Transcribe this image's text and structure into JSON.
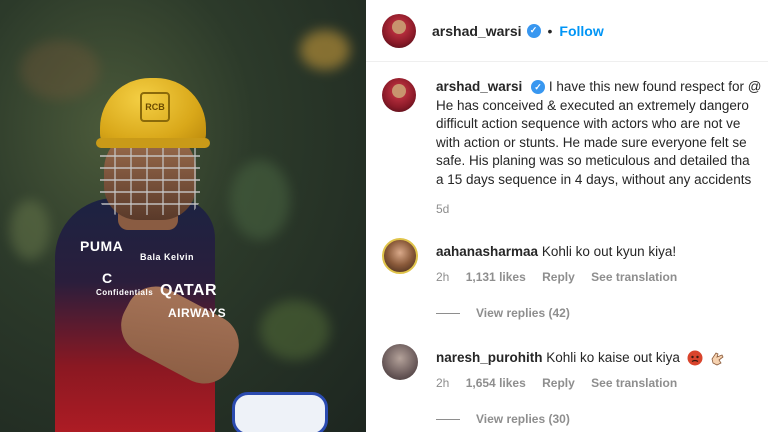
{
  "post": {
    "author": "arshad_warsi",
    "follow_label": "Follow",
    "separator": "•",
    "caption_lines": [
      "I have this new found respect for @",
      "He has conceived & executed an extremely dangero",
      "difficult action sequence with actors who are not ve",
      "with action or stunts. He made sure everyone felt se",
      "safe. His planing was so meticulous and detailed tha",
      "a 15 days sequence in 4 days, without any accidents"
    ],
    "caption_time": "5d"
  },
  "photo": {
    "helmet_text": "RCB",
    "sponsor_1": "QATAR",
    "sponsor_2": "AIRWAYS",
    "brand": "PUMA",
    "sponsor_3": "Bala Kelvin",
    "sponsor_4": "C",
    "sponsor_5": "Confidentials"
  },
  "comments": [
    {
      "username": "aahanasharmaa",
      "text": "Kohli ko out kyun kiya!",
      "time": "2h",
      "likes": "1,131 likes",
      "reply_label": "Reply",
      "translate_label": "See translation",
      "view_replies": "View replies (42)"
    },
    {
      "username": "naresh_purohith",
      "text": "Kohli ko kaise out kiya",
      "time": "2h",
      "likes": "1,654 likes",
      "reply_label": "Reply",
      "translate_label": "See translation",
      "view_replies": "View replies (30)"
    }
  ],
  "colors": {
    "link": "#0095f6",
    "verified": "#3897f0",
    "muted": "#8e8e8e"
  },
  "icons": [
    "verified-badge-icon",
    "angry-face-emoji-icon",
    "clap-hand-emoji-icon"
  ]
}
